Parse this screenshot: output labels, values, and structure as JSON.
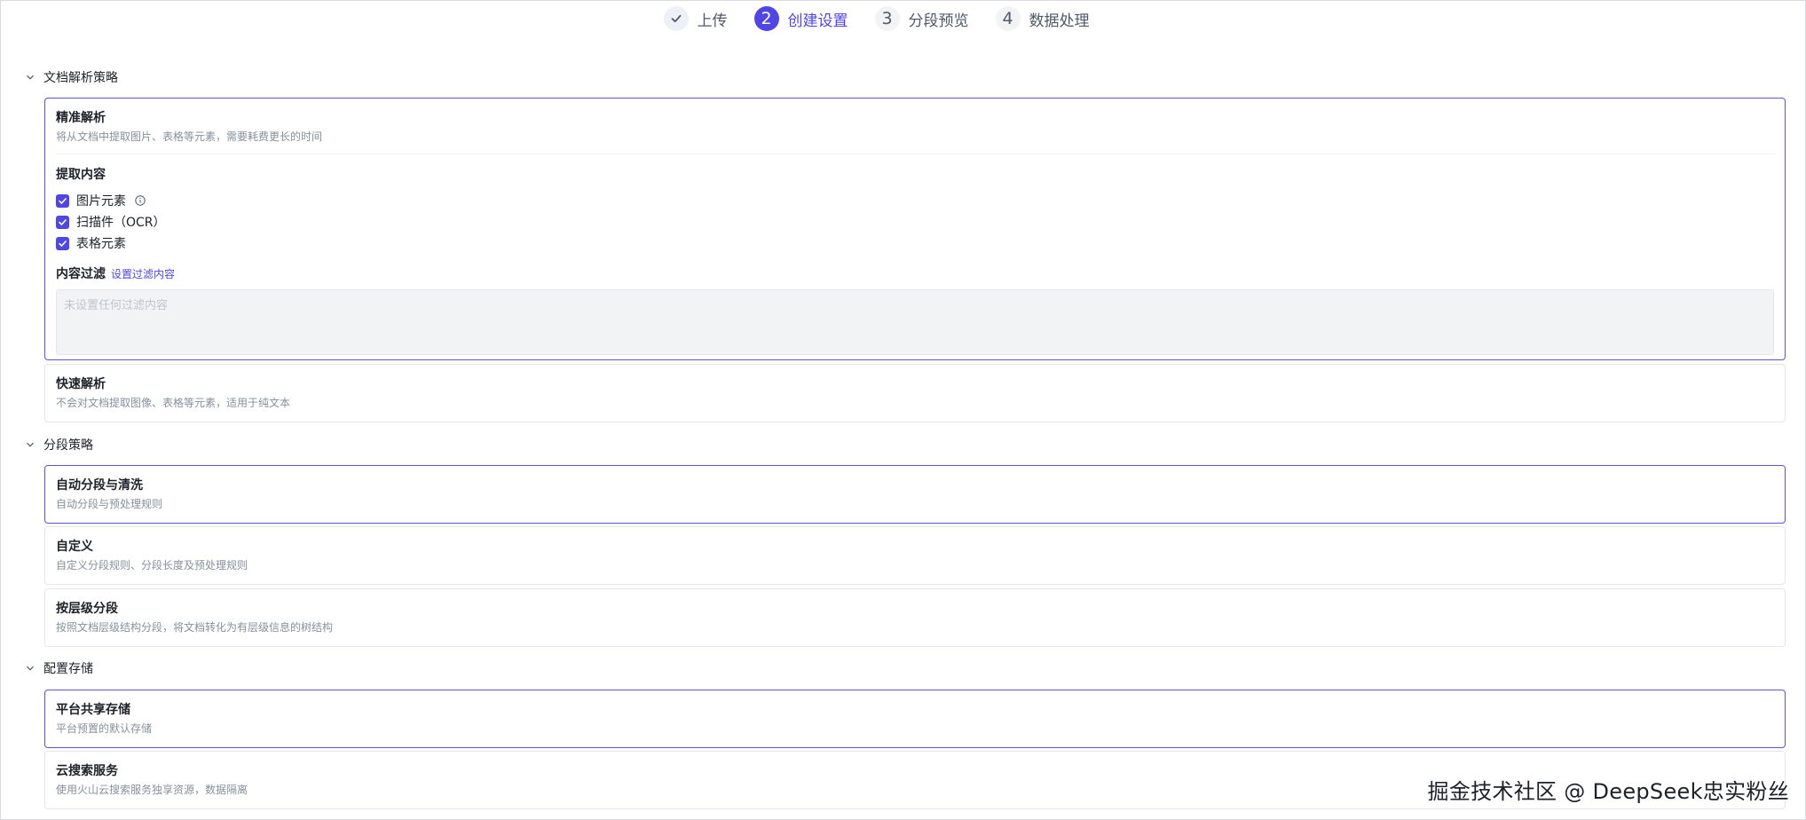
{
  "steps": [
    {
      "number": "",
      "label": "上传"
    },
    {
      "number": "2",
      "label": "创建设置"
    },
    {
      "number": "3",
      "label": "分段预览"
    },
    {
      "number": "4",
      "label": "数据处理"
    }
  ],
  "parse": {
    "section_title": "文档解析策略",
    "precise": {
      "title": "精准解析",
      "desc": "将从文档中提取图片、表格等元素，需要耗费更长的时间",
      "extract_title": "提取内容",
      "options": [
        "图片元素",
        "扫描件（OCR）",
        "表格元素"
      ],
      "filter_label": "内容过滤",
      "filter_link": "设置过滤内容",
      "filter_placeholder": "未设置任何过滤内容"
    },
    "fast": {
      "title": "快速解析",
      "desc": "不会对文档提取图像、表格等元素，适用于纯文本"
    }
  },
  "segment": {
    "section_title": "分段策略",
    "options": [
      {
        "title": "自动分段与清洗",
        "desc": "自动分段与预处理规则"
      },
      {
        "title": "自定义",
        "desc": "自定义分段规则、分段长度及预处理规则"
      },
      {
        "title": "按层级分段",
        "desc": "按照文档层级结构分段，将文档转化为有层级信息的树结构"
      }
    ]
  },
  "storage": {
    "section_title": "配置存储",
    "options": [
      {
        "title": "平台共享存储",
        "desc": "平台预置的默认存储"
      },
      {
        "title": "云搜索服务",
        "desc": "使用火山云搜索服务独享资源，数据隔离"
      }
    ]
  },
  "watermark": "掘金技术社区 @ DeepSeek忠实粉丝",
  "colors": {
    "accent": "#4f46e5",
    "border": "#e5e6eb",
    "muted": "#86909c"
  }
}
